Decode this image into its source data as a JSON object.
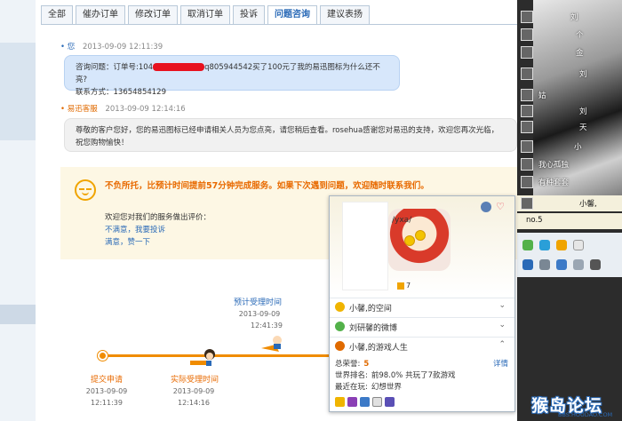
{
  "tabs": [
    {
      "label": "全部",
      "active": false
    },
    {
      "label": "催办订单",
      "active": false
    },
    {
      "label": "修改订单",
      "active": false
    },
    {
      "label": "取消订单",
      "active": false
    },
    {
      "label": "投诉",
      "active": false
    },
    {
      "label": "问题咨询",
      "active": true
    },
    {
      "label": "建议表扬",
      "active": false
    }
  ],
  "messages": {
    "user": {
      "name": "您",
      "time": "2013-09-09 12:11:39",
      "line1_a": "咨询问题：订单号:104",
      "line1_b": "q805944542买了100元了我的易迅图标为什么还不亮?",
      "line2": "联系方式：13654854129"
    },
    "service": {
      "name": "易迅客服",
      "time": "2013-09-09 12:14:16",
      "line1": "尊敬的客户您好，您的易迅图标已经申请相关人员为您点亮，请您稍后查看。rosehua感谢您对易迅的支持，欢迎您再次光临，",
      "line2": "祝您购物愉快！"
    }
  },
  "notice": {
    "title": "不负所托，比预计时间提前57分钟完成服务。如果下次遇到问题，欢迎随时联系我们。",
    "rate_prompt": "欢迎您对我们的服务做出评价：",
    "unsatisfied": "不满意，我要投诉",
    "satisfied": "满意，赞一下"
  },
  "timeline": {
    "submit": {
      "label": "提交申请",
      "date": "2013-09-09",
      "time": "12:11:39"
    },
    "actual": {
      "label": "实际受理时间",
      "date": "2013-09-09",
      "time": "12:14:16"
    },
    "expected": {
      "label": "预计受理时间",
      "date": "2013-09-09",
      "time": "12:41:39"
    }
  },
  "right_panel": {
    "rows": [
      "刘",
      "个",
      "金",
      "刘",
      "姑",
      "刘",
      "天",
      "小",
      "恐",
      "我心孤独",
      "有种套套",
      "小馨,",
      "no.5"
    ],
    "highlight_name": "小馨,"
  },
  "card": {
    "signature": "/yxa/",
    "level": "7",
    "rows": [
      {
        "label": "小馨,的空间",
        "chev": "⌄"
      },
      {
        "label": "刘研馨的微博",
        "chev": "⌄"
      },
      {
        "label": "小馨,的游戏人生",
        "chev": "⌃"
      }
    ],
    "honor_label": "总荣誉:",
    "honor_value": "5",
    "detail_link": "详情",
    "rank_label": "世界排名:",
    "rank_value": "前98.0%  共玩了7款游戏",
    "playing_label": "最近在玩:",
    "playing_value": "幻想世界"
  },
  "watermark": {
    "main": "猴岛论坛",
    "sub": "BBS.HOUDAO.COM"
  },
  "colors": {
    "accent_blue": "#2a6ab7",
    "orange": "#f08c00",
    "notice_bg": "#fdf7e4"
  }
}
